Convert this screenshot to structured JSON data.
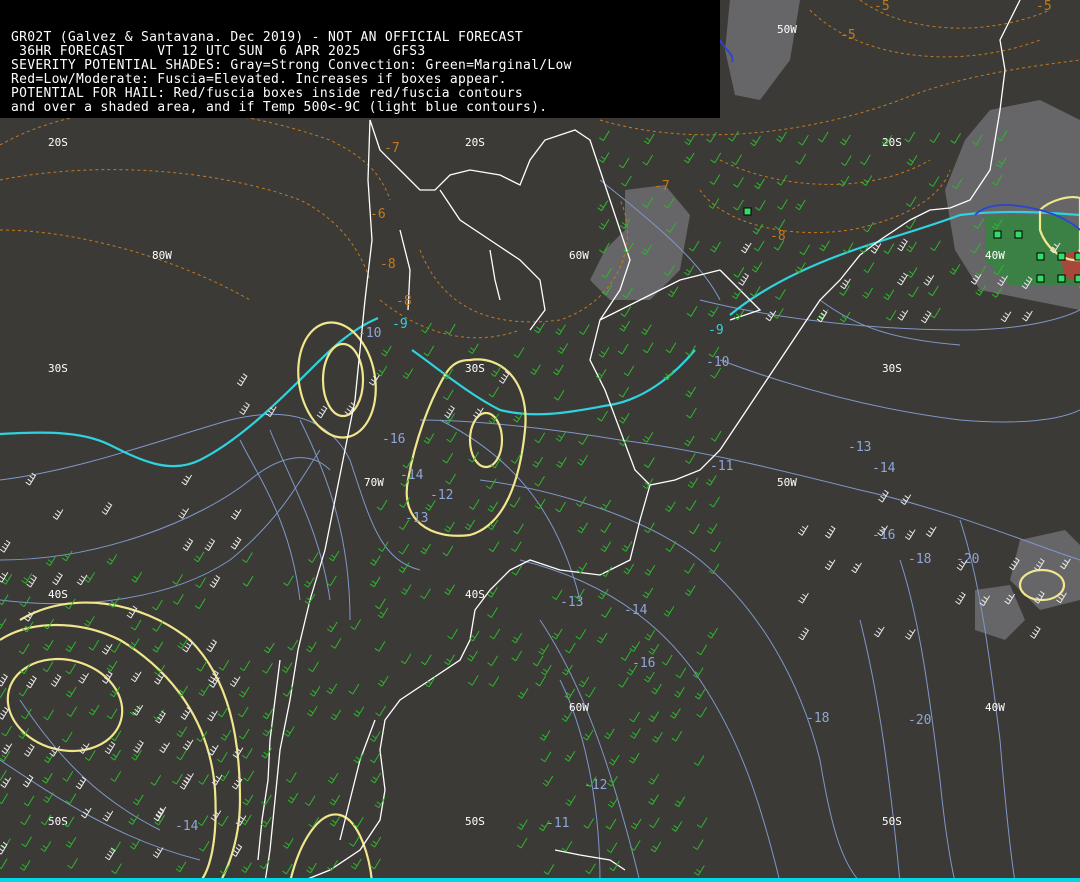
{
  "header": {
    "lines": [
      "GR02T (Galvez & Santavana. Dec 2019) - NOT AN OFFICIAL FORECAST",
      " 36HR FORECAST    VT 12 UTC SUN  6 APR 2025    GFS3",
      "SEVERITY POTENTIAL SHADES: Gray=Strong Convection: Green=Marginal/Low",
      "Red=Low/Moderate: Fuscia=Elevated. Increases if boxes appear.",
      "POTENTIAL FOR HAIL: Red/fuscia boxes inside red/fuscia contours",
      "and over a shaded area, and if Temp 500<-9C (light blue contours)."
    ]
  },
  "grid_labels": [
    "20S",
    "20S",
    "20S",
    "80W",
    "60W",
    "40W",
    "30S",
    "30S",
    "30S",
    "70W",
    "50W",
    "40S",
    "40S",
    "60W",
    "40W",
    "50S",
    "50S",
    "50S",
    "50W"
  ],
  "temp_labels": [
    "-10",
    "-16",
    "-14",
    "-12",
    "-13",
    "-10",
    "-11",
    "-13",
    "-14",
    "-16",
    "-18",
    "-20",
    "-13",
    "-14",
    "-16",
    "-12",
    "-11",
    "-18",
    "-20",
    "-14"
  ],
  "orange_labels": [
    "-5",
    "-5",
    "-5",
    "-6",
    "-7",
    "-8",
    "-8",
    "-7",
    "-8"
  ],
  "cyan_labels": [
    "-9",
    "-9"
  ],
  "colors": {
    "background": "#3b3a36",
    "land_outline": "#ffffff",
    "temp_contours": "#8fa6d9",
    "cyan_contour": "#2fd3df",
    "yellow_contour": "#f0e68c",
    "orange_contour": "#c47a1c",
    "wind_barbs_green": "#2fb52f",
    "wind_barbs_white": "#e8e8e8",
    "gray_shade": "#6e6d70",
    "marker_green": "#33dd66"
  }
}
